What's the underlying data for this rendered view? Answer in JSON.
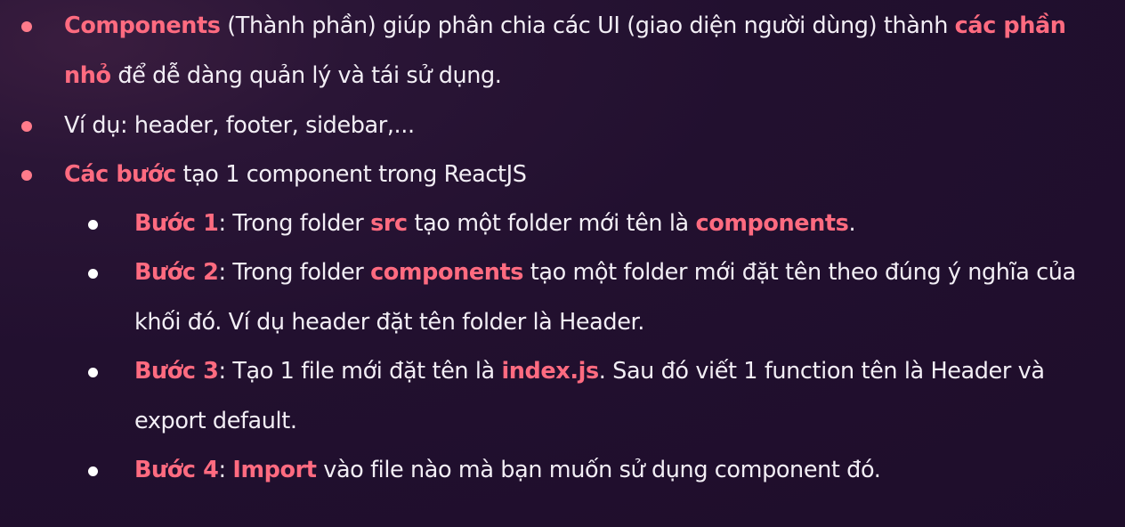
{
  "colors": {
    "background": "#22102f",
    "text": "#f2eef5",
    "highlight": "#ff6b80",
    "bullet_level1": "#ff7b8b",
    "bullet_level2": "#ffffff"
  },
  "items": [
    {
      "level": 1,
      "line1": {
        "bold1": "Components",
        "text1": " (Thành phần) giúp phân chia các UI (giao diện người dùng) thành ",
        "bold2": "các phần"
      },
      "line2": {
        "bold1": "nhỏ",
        "text1": " để dễ dàng quản lý và tái sử dụng."
      }
    },
    {
      "level": 1,
      "line1": {
        "text1": "Ví dụ: header, footer, sidebar,..."
      }
    },
    {
      "level": 1,
      "line1": {
        "bold1": "Các bước",
        "text1": " tạo 1 component trong ReactJS"
      }
    },
    {
      "level": 2,
      "line1": {
        "bold1": "Bước 1",
        "text1": ": Trong folder ",
        "bold2": "src",
        "text2": " tạo một folder mới tên là ",
        "bold3": "components",
        "text3": "."
      }
    },
    {
      "level": 2,
      "line1": {
        "bold1": "Bước 2",
        "text1": ": Trong folder ",
        "bold2": "components",
        "text2": " tạo một folder mới đặt tên theo đúng ý nghĩa của"
      },
      "line2": {
        "text1": "khối đó. Ví dụ header đặt tên folder là Header."
      }
    },
    {
      "level": 2,
      "line1": {
        "bold1": "Bước 3",
        "text1": ": Tạo 1 file mới đặt tên là ",
        "bold2": "index.js",
        "text2": ". Sau đó viết 1 function tên là Header và"
      },
      "line2": {
        "text1": "export default."
      }
    },
    {
      "level": 2,
      "line1": {
        "bold1": "Bước 4",
        "text1": ": ",
        "bold2": "Import",
        "text2": " vào file nào mà bạn muốn sử dụng component đó."
      }
    }
  ]
}
